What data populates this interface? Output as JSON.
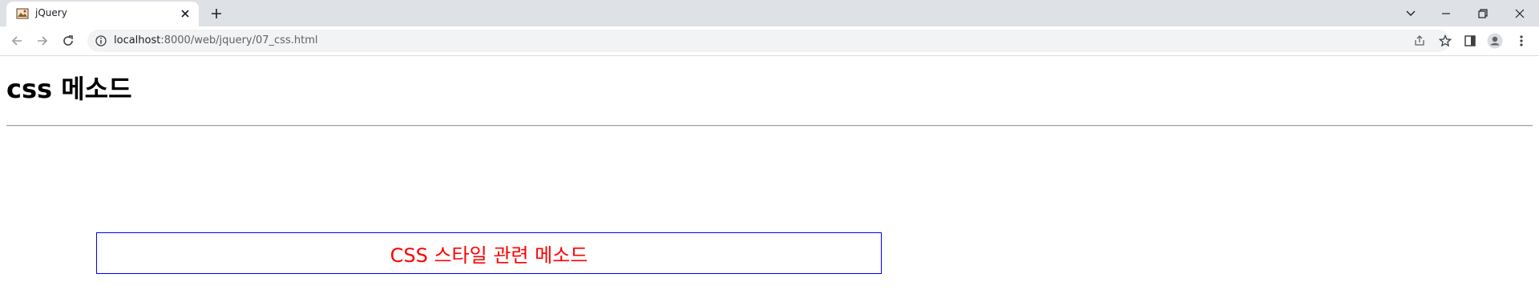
{
  "browser": {
    "tab": {
      "title": "jQuery",
      "favicon_icon": "image-icon"
    },
    "address": {
      "host": "localhost",
      "path": ":8000/web/jquery/07_css.html"
    },
    "icons": {
      "back": "arrow-left-icon",
      "forward": "arrow-right-icon",
      "reload": "reload-icon",
      "info": "info-icon",
      "share": "share-icon",
      "bookmark": "star-icon",
      "side_panel": "side-panel-icon",
      "profile": "profile-icon",
      "menu": "kebab-menu-icon",
      "tab_search": "chevron-down-icon",
      "minimize": "minimize-icon",
      "restore": "restore-icon",
      "close": "close-icon",
      "new_tab": "plus-icon"
    }
  },
  "page": {
    "heading": "css 메소드",
    "box_text": "CSS 스타일 관련 메소드"
  },
  "colors": {
    "box_border": "#0000ff",
    "box_text": "#ff0000",
    "tabbar_bg": "#dee1e6",
    "omnibox_bg": "#f1f3f4"
  }
}
